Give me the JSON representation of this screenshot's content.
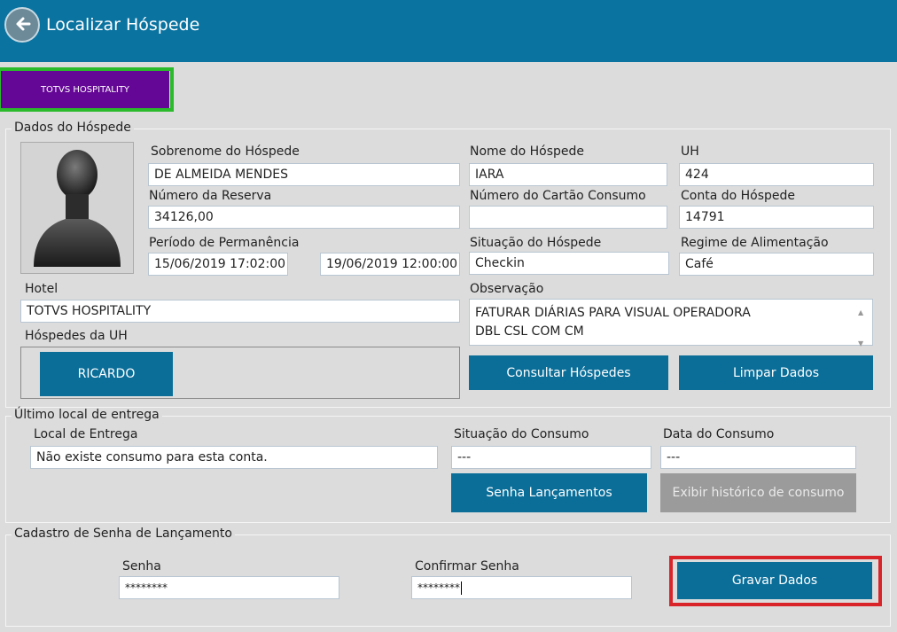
{
  "window": {
    "title": "Localizar Hóspede"
  },
  "hotel_button": {
    "label": "TOTVS HOSPITALITY"
  },
  "guest": {
    "section_title": "Dados do Hóspede",
    "surname_label": "Sobrenome do Hóspede",
    "surname_value": "DE ALMEIDA MENDES",
    "name_label": "Nome do Hóspede",
    "name_value": "IARA",
    "uh_label": "UH",
    "uh_value": "424",
    "reservation_label": "Número da Reserva",
    "reservation_value": "34126,00",
    "card_label": "Número do Cartão Consumo",
    "card_value": "",
    "account_label": "Conta do Hóspede",
    "account_value": "14791",
    "stay_label": "Período de Permanência",
    "stay_start": "15/06/2019 17:02:00",
    "stay_end": "19/06/2019 12:00:00",
    "status_label": "Situação do Hóspede",
    "status_value": "Checkin",
    "meal_label": "Regime de Alimentação",
    "meal_value": "Café",
    "hotel_label": "Hotel",
    "hotel_value": "TOTVS HOSPITALITY",
    "obs_label": "Observação",
    "obs_line1": "FATURAR DIÁRIAS PARA VISUAL OPERADORA",
    "obs_line2": "DBL CSL COM CM",
    "uh_guests_label": "Hóspedes da UH",
    "uh_guests": [
      "RICARDO"
    ],
    "consult_button": "Consultar Hóspedes",
    "clear_button": "Limpar Dados"
  },
  "delivery": {
    "section_title": "Último local de entrega",
    "place_label": "Local de Entrega",
    "place_value": "Não existe consumo para esta conta.",
    "consumption_status_label": "Situação do Consumo",
    "consumption_status_value": "---",
    "consumption_date_label": "Data do Consumo",
    "consumption_date_value": "---",
    "password_launch_button": "Senha Lançamentos",
    "history_button": "Exibir histórico de consumo"
  },
  "password": {
    "section_title": "Cadastro de Senha de Lançamento",
    "password_label": "Senha",
    "password_value": "********",
    "confirm_label": "Confirmar Senha",
    "confirm_value": "********",
    "save_button": "Gravar Dados"
  },
  "colors": {
    "header": "#0a73a0",
    "primary_button": "#0a6e99",
    "hotel_button": "#650796",
    "disabled_button": "#9b9b9b",
    "highlight_green": "#2bba2b",
    "highlight_red": "#d9252a"
  }
}
